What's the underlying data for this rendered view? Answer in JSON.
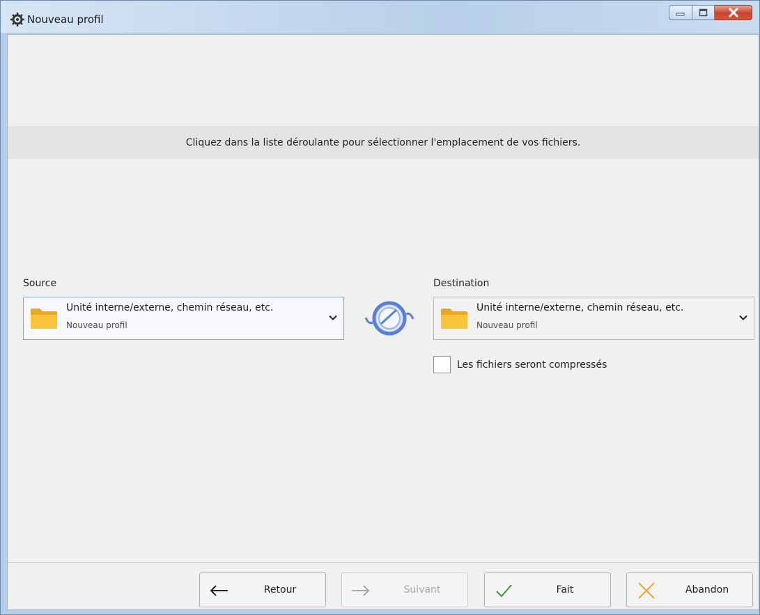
{
  "window": {
    "title": "Nouveau profil"
  },
  "banner": {
    "text": "Cliquez dans la liste déroulante pour sélectionner l'emplacement de vos fichiers."
  },
  "source": {
    "label": "Source",
    "primary": "Unité interne/externe, chemin réseau, etc.",
    "secondary": "Nouveau profil"
  },
  "destination": {
    "label": "Destination",
    "primary": "Unité interne/externe, chemin réseau, etc.",
    "secondary": "Nouveau profil"
  },
  "compress": {
    "label": "Les fichiers seront compressés",
    "checked": false
  },
  "footer": {
    "back_label": "Retour",
    "next_label": "Suivant",
    "done_label": "Fait",
    "cancel_label": "Abandon"
  },
  "colors": {
    "folder": "#f5b928",
    "sync_icon": "#5b7fd6",
    "done_check": "#3a9a3a",
    "cancel_x": "#f1a531",
    "close_button": "#c7442c"
  },
  "icons": {
    "app": "app-gear-icon",
    "folder": "folder-icon",
    "sync": "sync-mirror-icon",
    "dropdown": "chevron-down-icon",
    "back": "arrow-left-icon",
    "next": "arrow-right-icon",
    "done": "checkmark-icon",
    "cancel": "x-icon"
  }
}
